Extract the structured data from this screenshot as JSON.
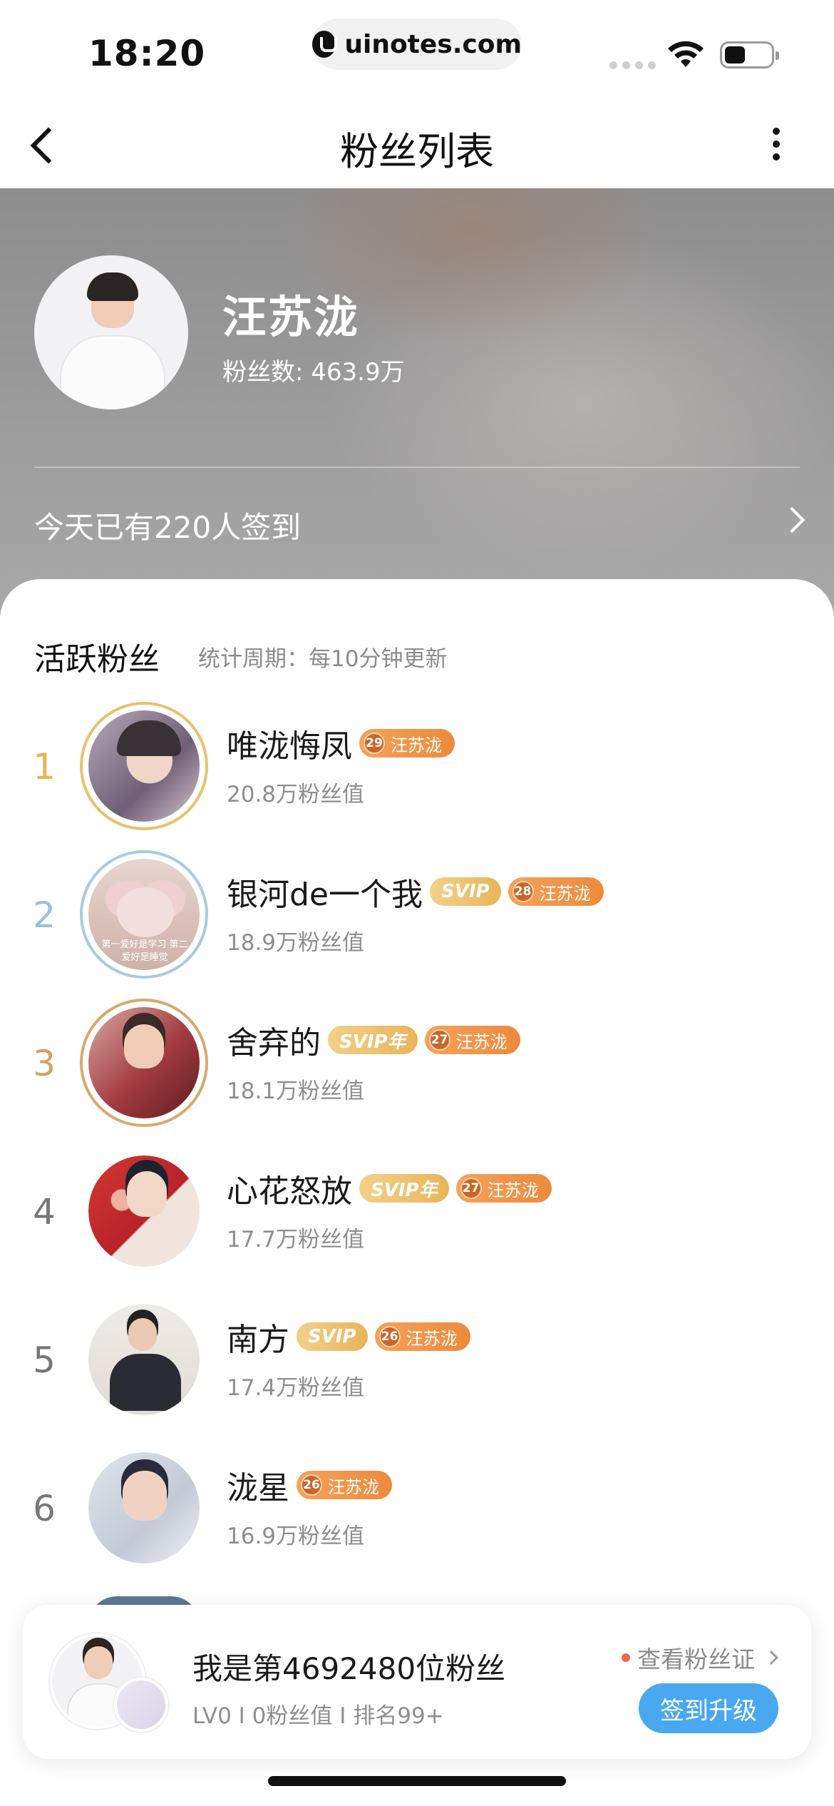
{
  "status_bar": {
    "time": "18:20",
    "url": "uinotes.com"
  },
  "nav": {
    "title": "粉丝列表"
  },
  "star": {
    "name": "汪苏泷",
    "fans": "粉丝数: 463.9万",
    "checkin_text": "今天已有220人签到"
  },
  "active_fans": {
    "title": "活跃粉丝",
    "subtitle": "统计周期：每10分钟更新"
  },
  "fans": [
    {
      "rank": "1",
      "name": "唯泷悔凤",
      "svip": "",
      "level": "29",
      "badge": "汪苏泷",
      "value": "20.8万粉丝值"
    },
    {
      "rank": "2",
      "name": "银河de一个我",
      "svip": "SVIP",
      "level": "28",
      "badge": "汪苏泷",
      "value": "18.9万粉丝值"
    },
    {
      "rank": "3",
      "name": "舍弃的",
      "svip": "SVIP年",
      "level": "27",
      "badge": "汪苏泷",
      "value": "18.1万粉丝值"
    },
    {
      "rank": "4",
      "name": "心花怒放",
      "svip": "SVIP年",
      "level": "27",
      "badge": "汪苏泷",
      "value": "17.7万粉丝值"
    },
    {
      "rank": "5",
      "name": "南方",
      "svip": "SVIP",
      "level": "26",
      "badge": "汪苏泷",
      "value": "17.4万粉丝值"
    },
    {
      "rank": "6",
      "name": "泷星",
      "svip": "",
      "level": "26",
      "badge": "汪苏泷",
      "value": "16.9万粉丝值"
    }
  ],
  "fan2_caption": "第一爱好是学习 第二爱好是睡觉",
  "me": {
    "rank_text": "我是第4692480位粉丝",
    "stats": "LV0 I 0粉丝值 I 排名99+",
    "view_cert": "查看粉丝证",
    "checkin_button": "签到升级"
  },
  "colors": {
    "accent_blue": "#4aa8f0",
    "badge_orange": "#ec8a3c",
    "svip_gold": "#e8b45a",
    "rank_gold": "#e9b44c",
    "rank_silver": "#9bc1d8",
    "rank_bronze": "#d8a060"
  }
}
